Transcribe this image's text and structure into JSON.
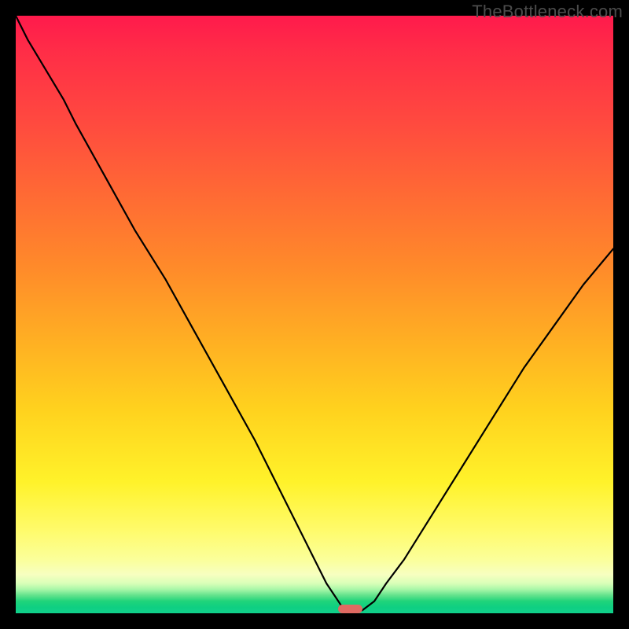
{
  "watermark": "TheBottleneck.com",
  "colors": {
    "frame": "#000000",
    "gradient_top": "#ff1a4c",
    "gradient_mid": "#ffd21e",
    "gradient_bottom": "#10d18c",
    "curve": "#000000",
    "marker": "#e06a62"
  },
  "chart_data": {
    "type": "line",
    "title": "",
    "xlabel": "",
    "ylabel": "",
    "xlim": [
      0,
      100
    ],
    "ylim": [
      0,
      100
    ],
    "x": [
      0,
      2,
      5,
      8,
      10,
      15,
      20,
      25,
      30,
      35,
      40,
      45,
      50,
      52,
      54,
      55,
      56,
      58,
      60,
      62,
      65,
      70,
      75,
      80,
      85,
      90,
      95,
      100
    ],
    "values": [
      100,
      96,
      91,
      86,
      82,
      73,
      64,
      56,
      47,
      38,
      29,
      19,
      9,
      5,
      2,
      0.5,
      0,
      0.5,
      2,
      5,
      9,
      17,
      25,
      33,
      41,
      48,
      55,
      61
    ],
    "marker": {
      "x": 56,
      "y": 0,
      "width_x": 4,
      "height_y": 1.5
    },
    "grid": false,
    "legend": false
  }
}
